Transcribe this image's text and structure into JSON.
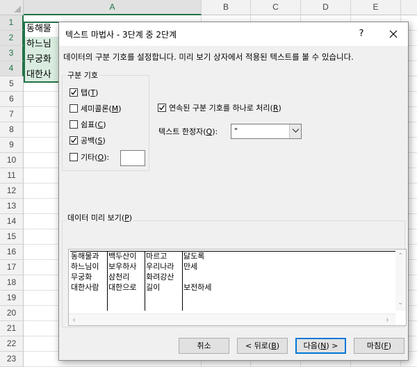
{
  "spreadsheet": {
    "columns": [
      "A",
      "B",
      "C",
      "D",
      "E"
    ],
    "rows": [
      "1",
      "2",
      "3",
      "4",
      "5",
      "6",
      "7",
      "8",
      "9",
      "10",
      "11",
      "12",
      "13",
      "14",
      "15",
      "16",
      "17",
      "18",
      "19",
      "20",
      "21",
      "22",
      "23"
    ],
    "cells": [
      "동해물",
      "하느님",
      "무궁화",
      "대한사"
    ],
    "accent_color": "#217346"
  },
  "dialog": {
    "title": "텍스트 마법사 - 3단계 중 2단계",
    "help_label": "?",
    "description": "데이터의 구분 기호를 설정합니다. 미리 보기 상자에서 적용된 텍스트를 볼 수 있습니다.",
    "delimiters": {
      "group_label": "구분 기호",
      "tab": {
        "label": "탭(",
        "key": "T",
        "end": ")",
        "checked": true
      },
      "semicolon": {
        "label": "세미콜론(",
        "key": "M",
        "end": ")",
        "checked": false
      },
      "comma": {
        "label": "쉼표(",
        "key": "C",
        "end": ")",
        "checked": false
      },
      "space": {
        "label": "공백(",
        "key": "S",
        "end": ")",
        "checked": true
      },
      "other": {
        "label": "기타(",
        "key": "O",
        "end": "):",
        "checked": false,
        "value": ""
      }
    },
    "consecutive": {
      "label": "연속된 구분 기호를 하나로 처리(",
      "key": "R",
      "end": ")",
      "checked": true
    },
    "qualifier": {
      "label": "텍스트 한정자(",
      "key": "Q",
      "end": "):",
      "value": "\""
    },
    "preview": {
      "group_label": "데이터 미리 보기(",
      "key": "P",
      "end": ")",
      "columns": [
        [
          "동해물과",
          "하느님이",
          "무궁화",
          "대한사람"
        ],
        [
          "백두산이",
          "보우하사",
          "삼천리",
          "대한으로"
        ],
        [
          "마르고",
          "우리나라",
          "화려강산",
          "길이"
        ],
        [
          "닳도록",
          "만세",
          "",
          "보전하세"
        ]
      ]
    },
    "buttons": {
      "cancel": "취소",
      "back": {
        "label": "< 뒤로(",
        "key": "B",
        "end": ")"
      },
      "next": {
        "label": "다음(",
        "key": "N",
        "end": ") >"
      },
      "finish": {
        "label": "마침(",
        "key": "F",
        "end": ")"
      }
    },
    "default_button_color": "#0078d7"
  }
}
